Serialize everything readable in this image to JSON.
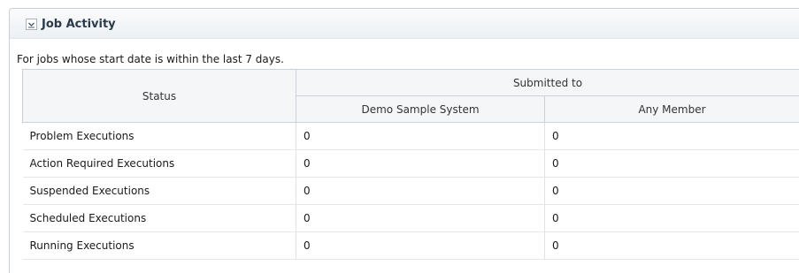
{
  "panel": {
    "title": "Job Activity",
    "toggle_icon": "collapse-chevron-icon",
    "subtitle": "For jobs whose start date is within the last 7 days."
  },
  "table": {
    "status_header": "Status",
    "group_header": "Submitted to",
    "columns": [
      "Demo Sample System",
      "Any Member"
    ],
    "rows": [
      {
        "label": "Problem Executions",
        "values": [
          "0",
          "0"
        ]
      },
      {
        "label": "Action Required Executions",
        "values": [
          "0",
          "0"
        ]
      },
      {
        "label": "Suspended Executions",
        "values": [
          "0",
          "0"
        ]
      },
      {
        "label": "Scheduled Executions",
        "values": [
          "0",
          "0"
        ]
      },
      {
        "label": "Running Executions",
        "values": [
          "0",
          "0"
        ]
      }
    ]
  }
}
